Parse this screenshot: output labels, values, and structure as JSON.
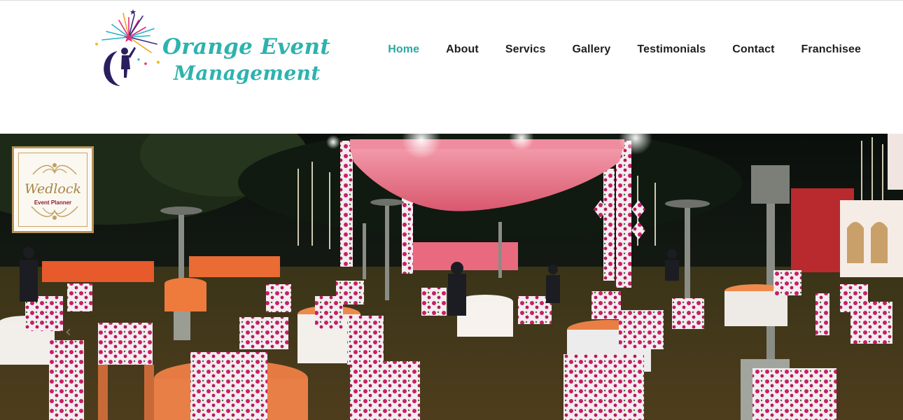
{
  "brand": {
    "line1": "Orange Event",
    "line2": "Management",
    "color": "#2db3ad",
    "logo_icon": "fireworks-moon-child-icon"
  },
  "nav": {
    "items": [
      {
        "label": "Home",
        "active": true
      },
      {
        "label": "About",
        "active": false
      },
      {
        "label": "Servics",
        "active": false
      },
      {
        "label": "Gallery",
        "active": false
      },
      {
        "label": "Testimonials",
        "active": false
      },
      {
        "label": "Contact",
        "active": false
      },
      {
        "label": "Franchisee",
        "active": false
      }
    ],
    "active_color": "#2aa8a2",
    "text_color": "#1f1f1f"
  },
  "hero": {
    "badge": {
      "script": "Wedlock",
      "subtitle": "Event Planner"
    },
    "prev_icon": "chevron-left-icon",
    "next_icon": "chevron-right-icon",
    "prev_glyph": "‹",
    "next_glyph": "›"
  }
}
